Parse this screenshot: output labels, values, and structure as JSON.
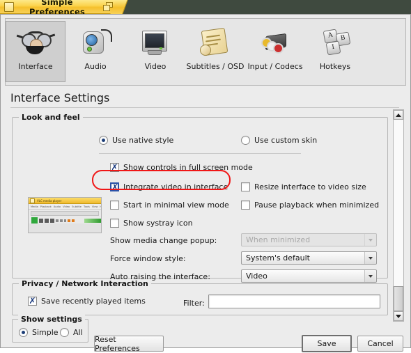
{
  "window": {
    "title": "Simple Preferences",
    "app_icon": "window-icon",
    "restore_icon": "restore-window-icon"
  },
  "toolbar": {
    "items": [
      {
        "label": "Interface",
        "icon": "glasses-icon",
        "selected": true
      },
      {
        "label": "Audio",
        "icon": "speaker-icon",
        "selected": false
      },
      {
        "label": "Video",
        "icon": "monitor-icon",
        "selected": false
      },
      {
        "label": "Subtitles / OSD",
        "icon": "scroll-icon",
        "selected": false
      },
      {
        "label": "Input / Codecs",
        "icon": "rca-plugs-icon",
        "selected": false
      },
      {
        "label": "Hotkeys",
        "icon": "keyboard-keys-icon",
        "selected": false
      }
    ]
  },
  "page": {
    "title": "Interface Settings"
  },
  "look_and_feel": {
    "title": "Look and feel",
    "style_radios": [
      {
        "label": "Use native style",
        "checked": true
      },
      {
        "label": "Use custom skin",
        "checked": false
      }
    ],
    "checkboxes_left": [
      {
        "label": "Show controls in full screen mode",
        "checked": true,
        "focused": false
      },
      {
        "label": "Integrate video in interface",
        "checked": true,
        "focused": true
      },
      {
        "label": "Start in minimal view mode",
        "checked": false,
        "focused": false
      },
      {
        "label": "Show systray icon",
        "checked": false,
        "focused": false
      }
    ],
    "checkboxes_right": [
      {
        "label": "Resize interface to video size",
        "checked": false
      },
      {
        "label": "Pause playback when minimized",
        "checked": false
      }
    ],
    "fields": [
      {
        "label": "Show media change popup:",
        "value": "When minimized",
        "disabled": true
      },
      {
        "label": "Force window style:",
        "value": "System's default",
        "disabled": false
      },
      {
        "label": "Auto raising the interface:",
        "value": "Video",
        "disabled": false
      }
    ],
    "preview": {
      "name": "vlc-window-preview",
      "title": "VLC media player",
      "menus": [
        "Media",
        "Playback",
        "Audio",
        "Video",
        "Subtitle",
        "Tools",
        "View",
        "Help"
      ]
    }
  },
  "privacy": {
    "title": "Privacy / Network Interaction",
    "checkbox": {
      "label": "Save recently played items",
      "checked": true
    },
    "filter_label": "Filter:",
    "filter_value": "",
    "filter_placeholder": ""
  },
  "show_settings": {
    "title": "Show settings",
    "options": [
      {
        "label": "Simple",
        "checked": true
      },
      {
        "label": "All",
        "checked": false
      }
    ]
  },
  "buttons": {
    "reset": "Reset Preferences",
    "save": "Save",
    "cancel": "Cancel"
  },
  "scrollbar": {
    "up_icon": "scroll-up-arrow-icon",
    "down_icon": "scroll-down-arrow-icon"
  },
  "annotation": {
    "shape": "red-oval-highlight",
    "target": "Integrate video in interface",
    "color": "#f01616"
  }
}
